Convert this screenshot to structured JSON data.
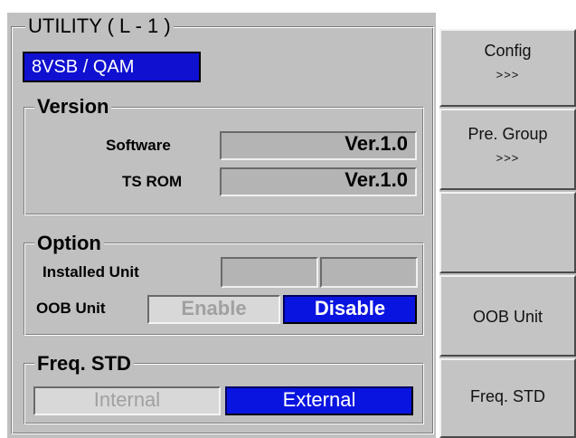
{
  "panel": {
    "title": "UTILITY ( L - 1 )",
    "mode_badge": "8VSB / QAM"
  },
  "version": {
    "legend": "Version",
    "software_label": "Software",
    "software_value": "Ver.1.0",
    "tsrom_label": "TS ROM",
    "tsrom_value": "Ver.1.0"
  },
  "option": {
    "legend": "Option",
    "installed_label": "Installed Unit",
    "installed_slot1": "",
    "installed_slot2": "",
    "oob_label": "OOB Unit",
    "oob_enable": "Enable",
    "oob_disable": "Disable",
    "oob_selected": "Disable"
  },
  "freq": {
    "legend": "Freq. STD",
    "internal": "Internal",
    "external": "External",
    "selected": "External"
  },
  "softkeys": [
    {
      "label": "Config",
      "sub": ">>>"
    },
    {
      "label": "Pre. Group",
      "sub": ">>>"
    },
    {
      "label": "",
      "sub": ""
    },
    {
      "label": "OOB Unit",
      "sub": ""
    },
    {
      "label": "Freq. STD",
      "sub": ""
    }
  ],
  "colors": {
    "panel_bg": "#c0c0c0",
    "selected_blue": "#0a14e0",
    "badge_blue": "#1010d0"
  }
}
